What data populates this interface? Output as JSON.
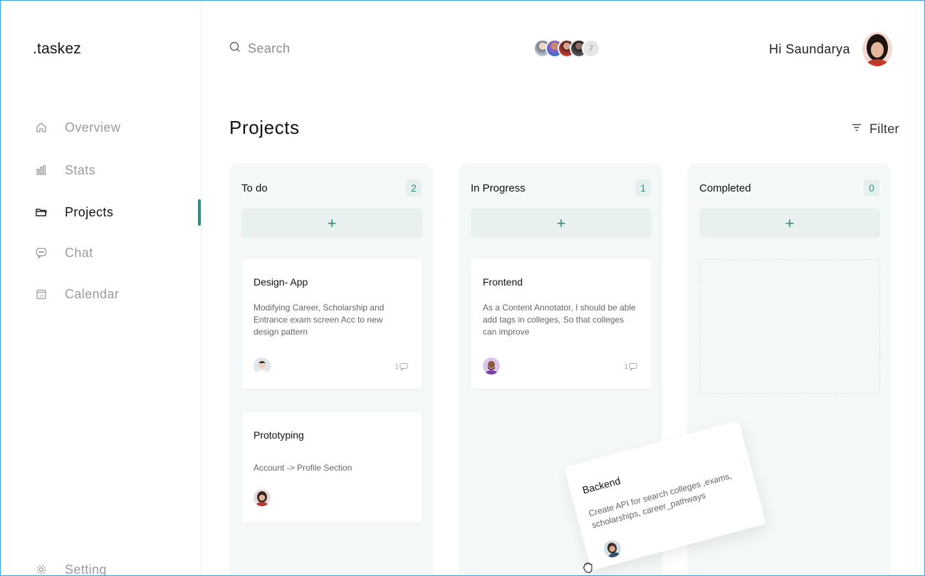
{
  "app": {
    "logo": ".taskez"
  },
  "sidebar": {
    "items": [
      {
        "label": "Overview",
        "icon": "home-icon",
        "active": false
      },
      {
        "label": "Stats",
        "icon": "stats-icon",
        "active": false
      },
      {
        "label": "Projects",
        "icon": "folder-icon",
        "active": true
      },
      {
        "label": "Chat",
        "icon": "chat-icon",
        "active": false
      },
      {
        "label": "Calendar",
        "icon": "calendar-icon",
        "active": false
      }
    ],
    "setting": {
      "label": "Setting",
      "icon": "gear-icon"
    }
  },
  "header": {
    "search": {
      "placeholder": "Search"
    },
    "team": {
      "more_count": "7"
    },
    "greeting": "Hi Saundarya"
  },
  "main": {
    "title": "Projects",
    "filter_label": "Filter"
  },
  "columns": [
    {
      "name": "To do",
      "count": "2",
      "add_label": "+",
      "cards": [
        {
          "title": "Design- App",
          "description": "Modifying Career, Scholarship and Entrance exam screen Acc to new design pattern",
          "comments": "1"
        },
        {
          "title": "Prototyping",
          "description": "Account -> Profile Section"
        }
      ]
    },
    {
      "name": "In Progress",
      "count": "1",
      "add_label": "+",
      "cards": [
        {
          "title": "Frontend",
          "description": "As a Content Annotator, I should be able add tags in colleges, So that colleges can improve",
          "comments": "1"
        }
      ]
    },
    {
      "name": "Completed",
      "count": "0",
      "add_label": "+",
      "cards": []
    }
  ],
  "dragging_card": {
    "title": "Backend",
    "description": "Create API for search colleges ,exams, scholarships, career_pathways"
  },
  "colors": {
    "accent": "#2f8f7c",
    "column_bg": "#f4f8f8",
    "add_bg": "#e9f1f0"
  }
}
